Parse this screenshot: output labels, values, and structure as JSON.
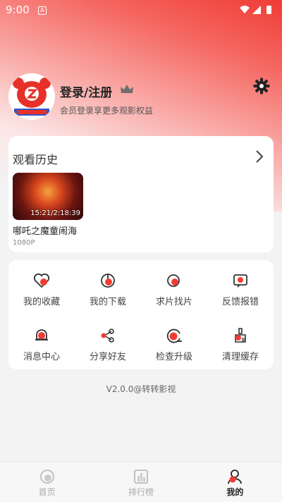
{
  "status_bar": {
    "time": "9:00",
    "sim_label": "A"
  },
  "profile": {
    "login_title": "登录/注册",
    "login_subtitle": "会员登录享更多观影权益"
  },
  "history": {
    "title": "观看历史",
    "items": [
      {
        "title": "哪吒之魔童闹海",
        "progress": "15:21/2:18:39",
        "resolution": "1080P"
      }
    ]
  },
  "menu": {
    "items": [
      {
        "label": "我的收藏",
        "icon": "heart-icon"
      },
      {
        "label": "我的下载",
        "icon": "download-icon"
      },
      {
        "label": "求片找片",
        "icon": "search-film-icon"
      },
      {
        "label": "反馈报错",
        "icon": "feedback-icon"
      },
      {
        "label": "消息中心",
        "icon": "bell-icon"
      },
      {
        "label": "分享好友",
        "icon": "share-icon"
      },
      {
        "label": "检查升级",
        "icon": "upgrade-icon"
      },
      {
        "label": "清理缓存",
        "icon": "broom-icon"
      }
    ]
  },
  "version": "V2.0.0@转转影视",
  "nav": {
    "tabs": [
      {
        "label": "首页",
        "icon": "home-icon",
        "active": false
      },
      {
        "label": "排行榜",
        "icon": "ranking-icon",
        "active": false
      },
      {
        "label": "我的",
        "icon": "profile-icon",
        "active": true
      }
    ]
  },
  "colors": {
    "accent": "#f03c36",
    "inactive": "#aaaaaa"
  }
}
